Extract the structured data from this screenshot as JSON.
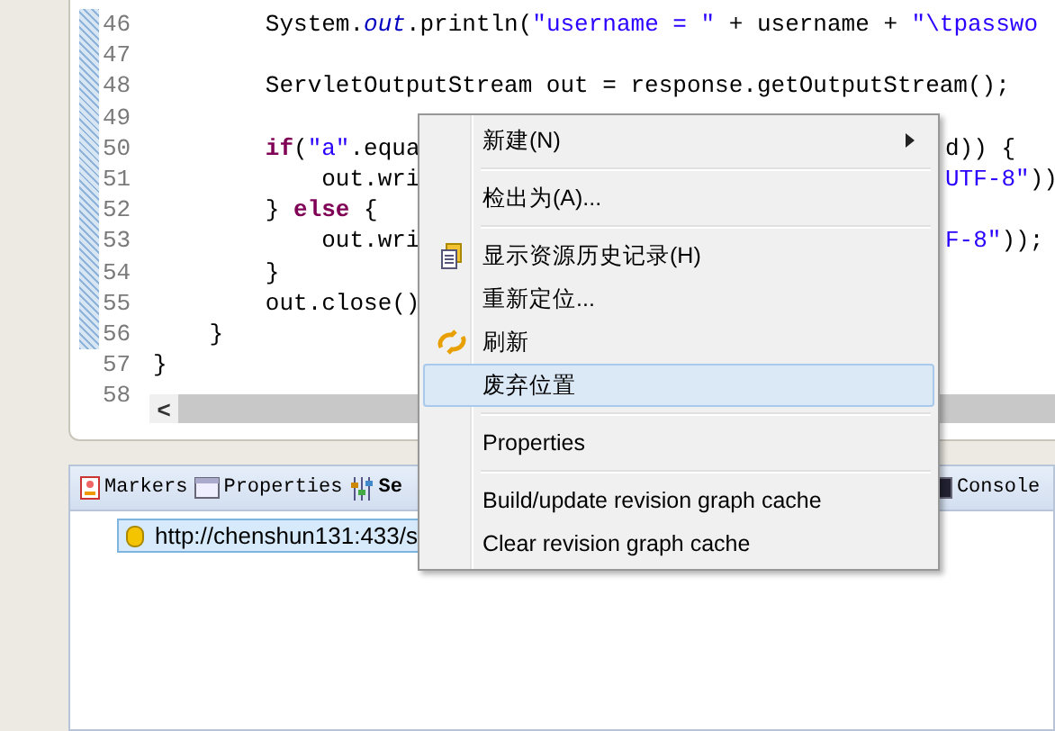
{
  "editor": {
    "lines": [
      {
        "number": "46",
        "left": [
          {
            "text": "        System.",
            "kind": "plain"
          },
          {
            "text": "out",
            "kind": "field"
          },
          {
            "text": ".println(",
            "kind": "plain"
          },
          {
            "text": "\"username = \"",
            "kind": "string"
          },
          {
            "text": " + username + ",
            "kind": "plain"
          },
          {
            "text": "\"\\tpasswo",
            "kind": "string"
          }
        ]
      },
      {
        "number": "47"
      },
      {
        "number": "48",
        "left": [
          {
            "text": "        ServletOutputStream out = response.getOutputStream();",
            "kind": "plain"
          }
        ]
      },
      {
        "number": "49"
      },
      {
        "number": "50",
        "left": [
          {
            "text": "        if",
            "kind": "keyword"
          },
          {
            "text": "(",
            "kind": "plain"
          },
          {
            "text": "\"a\"",
            "kind": "string"
          },
          {
            "text": ".equa",
            "kind": "plain"
          }
        ],
        "right": [
          {
            "text": "d)) {",
            "kind": "plain"
          }
        ]
      },
      {
        "number": "51",
        "left": [
          {
            "text": "            out.wri",
            "kind": "plain"
          }
        ],
        "right": [
          {
            "text": "UTF-8\"",
            "kind": "string"
          },
          {
            "text": "))",
            "kind": "plain"
          }
        ]
      },
      {
        "number": "52",
        "left": [
          {
            "text": "        } ",
            "kind": "plain"
          },
          {
            "text": "else",
            "kind": "keyword"
          },
          {
            "text": " {",
            "kind": "plain"
          }
        ]
      },
      {
        "number": "53",
        "left": [
          {
            "text": "            out.wri",
            "kind": "plain"
          }
        ],
        "right": [
          {
            "text": "F-8\"",
            "kind": "string"
          },
          {
            "text": "));",
            "kind": "plain"
          }
        ]
      },
      {
        "number": "54",
        "left": [
          {
            "text": "        }",
            "kind": "plain"
          }
        ]
      },
      {
        "number": "55",
        "left": [
          {
            "text": "        out.close()",
            "kind": "plain"
          }
        ]
      },
      {
        "number": "56",
        "left": [
          {
            "text": "    }",
            "kind": "plain"
          }
        ]
      },
      {
        "number": "57",
        "left": [
          {
            "text": "}",
            "kind": "plain"
          }
        ]
      },
      {
        "number": "58"
      }
    ],
    "scroll_left": "<"
  },
  "context_menu": [
    {
      "kind": "item",
      "label": "新建(N)",
      "submenu": true,
      "selected": false
    },
    {
      "kind": "separator"
    },
    {
      "kind": "item",
      "label": "检出为(A)...",
      "submenu": false,
      "selected": false
    },
    {
      "kind": "separator"
    },
    {
      "kind": "history",
      "label": "显示资源历史记录(H)",
      "submenu": false,
      "selected": false
    },
    {
      "kind": "item",
      "label": "重新定位...",
      "submenu": false,
      "selected": false
    },
    {
      "kind": "refresh",
      "label": "刷新",
      "submenu": false,
      "selected": false
    },
    {
      "kind": "item",
      "label": "废弃位置",
      "submenu": false,
      "selected": true
    },
    {
      "kind": "separator"
    },
    {
      "kind": "item",
      "label": "Properties",
      "submenu": false,
      "selected": false
    },
    {
      "kind": "separator"
    },
    {
      "kind": "item",
      "label": "Build/update revision graph cache",
      "submenu": false,
      "selected": false
    },
    {
      "kind": "item",
      "label": "Clear revision graph cache",
      "submenu": false,
      "selected": false
    }
  ],
  "bottom_panel": {
    "tabs": [
      {
        "label": "Markers",
        "selected": false
      },
      {
        "label": "Properties",
        "selected": false
      },
      {
        "label": "Se",
        "selected": true
      },
      {
        "label": "Console",
        "selected": false
      }
    ],
    "tree": [
      {
        "label": "http://chenshun131:433/s",
        "selected": true
      }
    ]
  }
}
